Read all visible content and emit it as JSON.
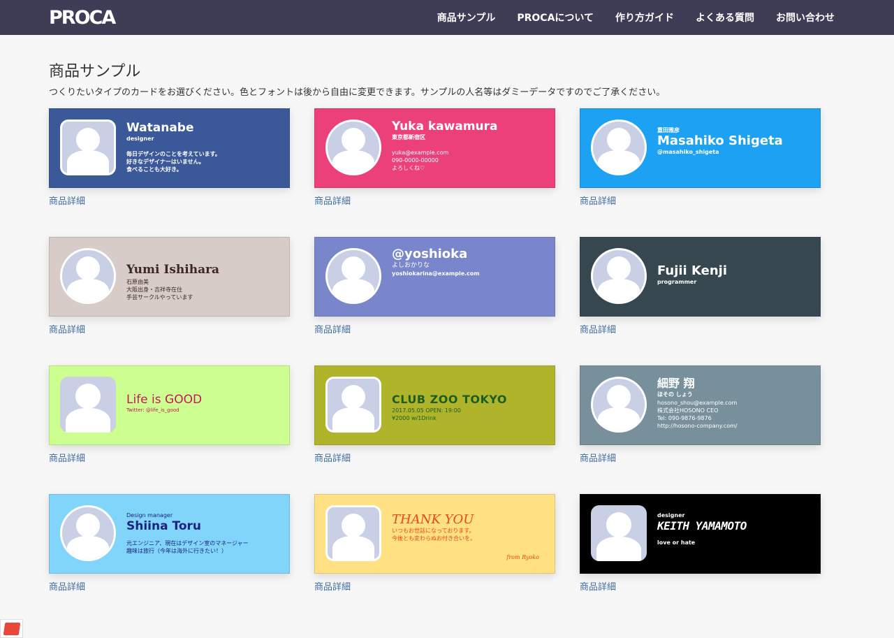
{
  "brand": "PROCA",
  "nav": [
    "商品サンプル",
    "PROCAについて",
    "作り方ガイド",
    "よくある質問",
    "お問い合わせ"
  ],
  "page": {
    "title": "商品サンプル",
    "subtitle": "つくりたいタイプのカードをお選びください。色とフォントは後から自由に変更できます。サンプルの人名等はダミーデータですのでご了承ください。"
  },
  "detail_label": "商品詳細",
  "cards": [
    {
      "bg": "#3b5998",
      "color": "#ffffff",
      "avatar": "rounded",
      "lines": [
        "Watanabe",
        "designer",
        "毎日デザインのことを考えています。",
        "好きなデザイナーはいません。",
        "食べることも大好き。"
      ]
    },
    {
      "bg": "#ec407a",
      "color": "#ffffff",
      "avatar": "circle",
      "lines": [
        "Yuka kawamura",
        "東京都新宿区",
        "yuka@example.com",
        "090-0000-00000",
        "よろしくね♡"
      ]
    },
    {
      "bg": "#1da1f2",
      "color": "#ffffff",
      "avatar": "circle",
      "lines": [
        "重田雅彦",
        "Masahiko Shigeta",
        "@masahiko_shigeta"
      ]
    },
    {
      "bg": "#d7ccc8",
      "color": "#3e2723",
      "avatar": "circle",
      "lines": [
        "Yumi Ishihara",
        "石原由美",
        "大阪出身・吉祥寺在住",
        "手芸サークルやっています"
      ]
    },
    {
      "bg": "#7986cb",
      "color": "#ffffff",
      "avatar": "circle",
      "lines": [
        "@yoshioka",
        "よしおかりな",
        "yoshiokarina@example.com"
      ]
    },
    {
      "bg": "#37474f",
      "color": "#ffffff",
      "avatar": "circle",
      "lines": [
        "Fujii Kenji",
        "programmer"
      ]
    },
    {
      "bg": "#ccff90",
      "color": "#c2185b",
      "avatar": "rounded-plain",
      "lines": [
        "Life is GOOD",
        "Twitter: @life_is_good"
      ]
    },
    {
      "bg": "#afb42b",
      "color": "#1b5e20",
      "avatar": "rounded",
      "lines": [
        "CLUB ZOO TOKYO",
        "2017.05.05 OPEN: 19:00",
        "¥2000 w/1Drink"
      ]
    },
    {
      "bg": "#78909c",
      "color": "#ffffff",
      "avatar": "circle",
      "lines": [
        "細野 翔",
        "ほその しょう",
        "hosono_shou@example.com",
        "株式会社HOSONO CEO",
        "Tel: 090-9876-9876",
        "http://hosono-company.com/"
      ]
    },
    {
      "bg": "#81d4fa",
      "color": "#1a237e",
      "avatar": "circle",
      "lines": [
        "Design manager",
        "Shiina Toru",
        "元エンジニア、現在はデザイン室のマネージャー",
        "趣味は旅行（今年は海外に行きたい！）"
      ]
    },
    {
      "bg": "#ffe082",
      "color": "#e64a19",
      "avatar": "rounded",
      "lines": [
        "THANK YOU",
        "いつもお世話になっております。",
        "今後とも変わらぬお付き合いを。",
        "from Ryoko"
      ]
    },
    {
      "bg": "#000000",
      "color": "#ffffff",
      "avatar": "rounded-plain",
      "lines": [
        "designer",
        "KEITH YAMAMOTO",
        "love or hate"
      ]
    }
  ]
}
